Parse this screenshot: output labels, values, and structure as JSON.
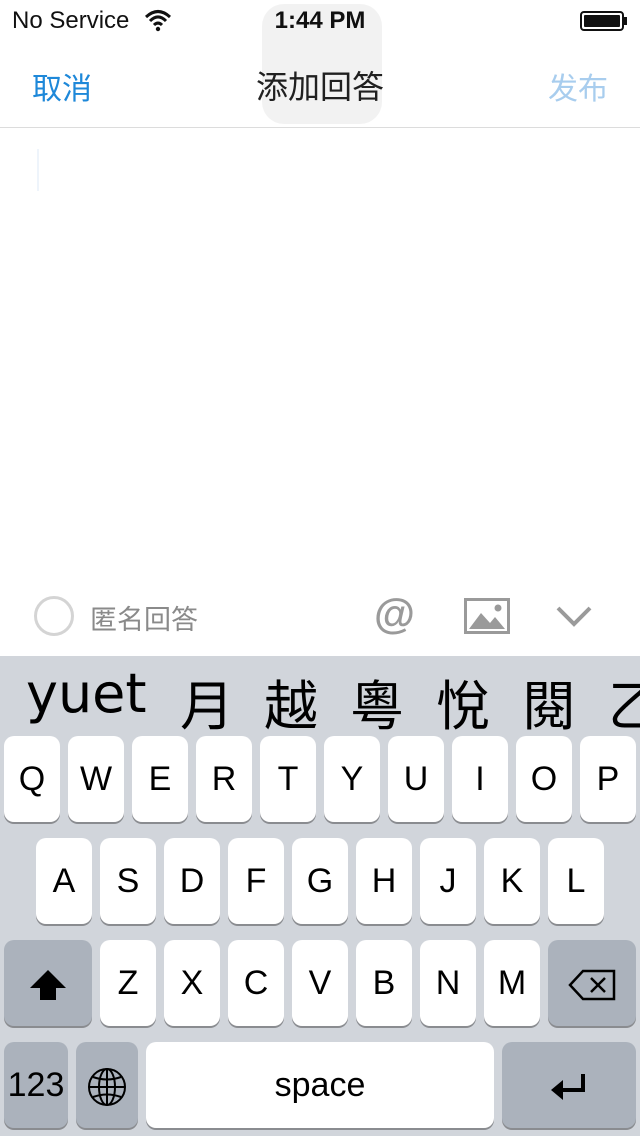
{
  "status_bar": {
    "carrier": "No Service",
    "time": "1:44 PM"
  },
  "nav": {
    "cancel": "取消",
    "title": "添加回答",
    "publish": "发布"
  },
  "toolbar": {
    "anonymous_label": "匿名回答",
    "mention_icon": "at-icon",
    "mention_glyph": "@",
    "image_icon": "image-icon",
    "collapse_icon": "chevron-down-icon"
  },
  "keyboard": {
    "candidates": [
      "yuet",
      "月",
      "越",
      "粵",
      "悅",
      "閱",
      "乙"
    ],
    "row1": [
      "Q",
      "W",
      "E",
      "R",
      "T",
      "Y",
      "U",
      "I",
      "O",
      "P"
    ],
    "row2": [
      "A",
      "S",
      "D",
      "F",
      "G",
      "H",
      "J",
      "K",
      "L"
    ],
    "row3": [
      "Z",
      "X",
      "C",
      "V",
      "B",
      "N",
      "M"
    ],
    "numbers_key": "123",
    "space_key": "space",
    "shift_icon": "shift-icon",
    "delete_icon": "backspace-icon",
    "globe_icon": "globe-icon",
    "return_icon": "return-icon"
  },
  "colors": {
    "accent": "#1e88d9",
    "accent_disabled": "#a8cdee",
    "keyboard_bg": "#d1d5db",
    "special_key": "#abb2bc"
  }
}
